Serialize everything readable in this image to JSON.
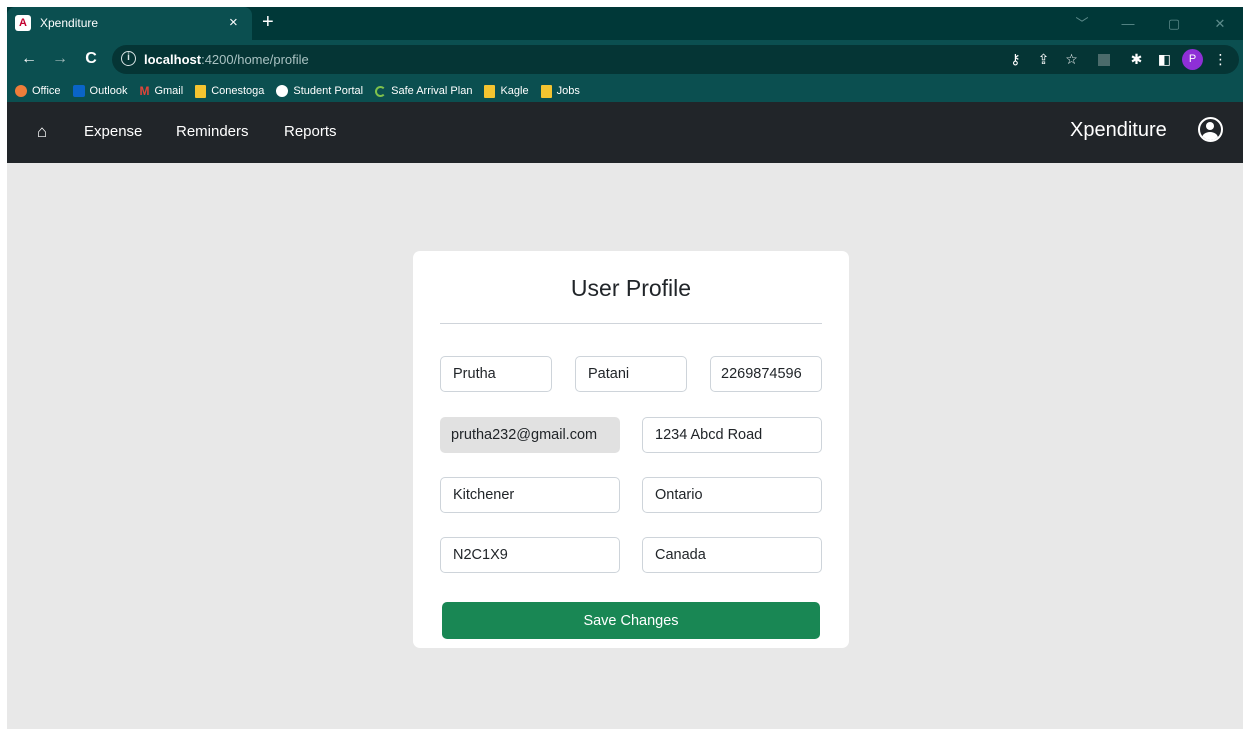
{
  "browser": {
    "tab": {
      "title": "Xpenditure",
      "favicon": "A",
      "close": "×"
    },
    "new_tab": "+",
    "window_controls": [
      "﹀",
      "—",
      "▢",
      "✕"
    ],
    "nav": {
      "back": "←",
      "forward": "→",
      "reload": "C"
    },
    "url": {
      "host": "localhost",
      "rest": ":4200/home/profile",
      "info": "i"
    },
    "omnibox_icons": [
      "key-icon",
      "share-icon",
      "star-icon"
    ],
    "toolbar_icons": [
      "extension-tile-icon",
      "puzzle-icon",
      "sidepanel-icon"
    ],
    "profile_initial": "P",
    "menu": "⋮",
    "bookmarks": [
      {
        "label": "Office",
        "icon": "office-icon"
      },
      {
        "label": "Outlook",
        "icon": "outlook-icon"
      },
      {
        "label": "Gmail",
        "icon": "gmail-icon"
      },
      {
        "label": "Conestoga",
        "icon": "folder-icon"
      },
      {
        "label": "Student Portal",
        "icon": "globe-icon"
      },
      {
        "label": "Safe Arrival Plan",
        "icon": "safe-arrival-icon"
      },
      {
        "label": "Kagle",
        "icon": "folder-icon"
      },
      {
        "label": "Jobs",
        "icon": "folder-icon"
      }
    ]
  },
  "navbar": {
    "home_icon": "home-icon",
    "links": [
      "Expense",
      "Reminders",
      "Reports"
    ],
    "brand": "Xpenditure",
    "user_icon": "user-circle-icon"
  },
  "profile": {
    "title": "User Profile",
    "first_name": "Prutha",
    "last_name": "Patani",
    "phone": "2269874596",
    "email": "prutha232@gmail.com",
    "address": "1234 Abcd Road",
    "city": "Kitchener",
    "province": "Ontario",
    "postal_code": "N2C1X9",
    "country": "Canada",
    "save_label": "Save Changes"
  },
  "colors": {
    "browser_frame": "#003838",
    "toolbar": "#0b4f50",
    "navbar": "#212529",
    "page_bg": "#e8e8e8",
    "save_button": "#198754",
    "profile_chip": "#8e2fd6"
  }
}
